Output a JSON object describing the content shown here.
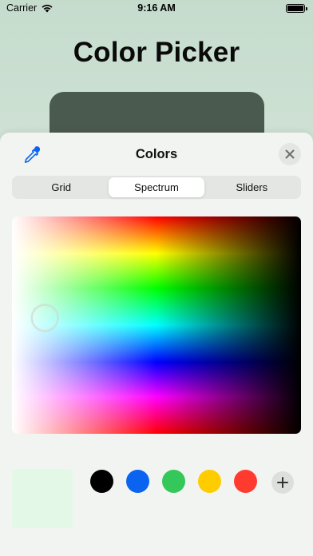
{
  "status_bar": {
    "carrier": "Carrier",
    "time": "9:16 AM"
  },
  "app": {
    "title": "Color Picker",
    "swatch_color": "#4b5a4f"
  },
  "sheet": {
    "title": "Colors",
    "tabs": [
      {
        "label": "Grid",
        "selected": false
      },
      {
        "label": "Spectrum",
        "selected": true
      },
      {
        "label": "Sliders",
        "selected": false
      }
    ],
    "current_color": "#e4f8e8",
    "preset_colors": [
      "#000000",
      "#0a64f0",
      "#34c759",
      "#ffcc00",
      "#ff3b30"
    ],
    "icons": {
      "eyedropper": "eyedropper-icon",
      "close": "close-icon",
      "add": "plus-icon"
    }
  }
}
